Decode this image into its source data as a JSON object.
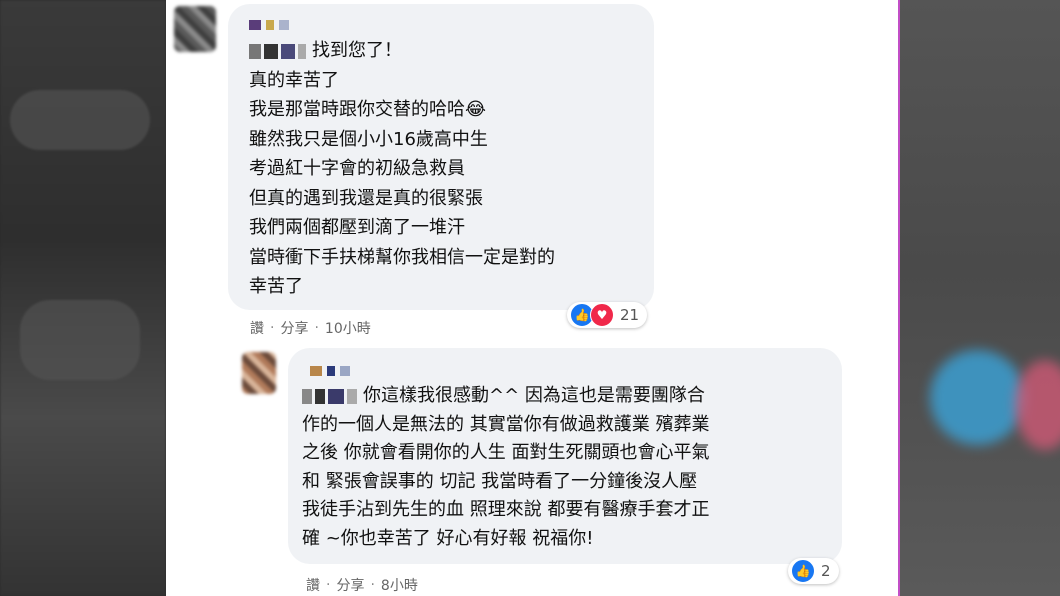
{
  "comments": [
    {
      "lines": [
        "找到您了！",
        "真的幸苦了",
        "我是那當時跟你交替的哈哈😂",
        "雖然我只是個小小16歲高中生",
        "考過紅十字會的初級急救員",
        "但真的遇到我還是真的很緊張",
        "我們兩個都壓到滴了一堆汗",
        "當時衝下手扶梯幫你我相信一定是對的",
        "幸苦了"
      ],
      "actions": {
        "like": "讚",
        "share": "分享",
        "time": "10小時",
        "dot": "·"
      },
      "reactions": {
        "count": "21",
        "icons": [
          "like-icon",
          "love-icon"
        ]
      }
    },
    {
      "lines": [
        "你這樣我很感動^^ 因為這也是需要團隊合",
        "作的一個人是無法的 其實當你有做過救護業 殯葬業",
        "之後 你就會看開你的人生 面對生死關頭也會心平氣",
        "和 緊張會誤事的 切記 我當時看了一分鐘後沒人壓",
        "我徒手沾到先生的血 照理來說 都要有醫療手套才正",
        "確 ~你也幸苦了 好心有好報 祝福你!"
      ],
      "actions": {
        "like": "讚",
        "share": "分享",
        "time": "8小時",
        "dot": "·"
      },
      "reactions": {
        "count": "2",
        "icons": [
          "like-icon"
        ]
      }
    }
  ],
  "colors": {
    "bubble": "#f0f2f5",
    "like": "#1877f2",
    "love": "#f0284a",
    "accent_border": "#c24fc7"
  }
}
